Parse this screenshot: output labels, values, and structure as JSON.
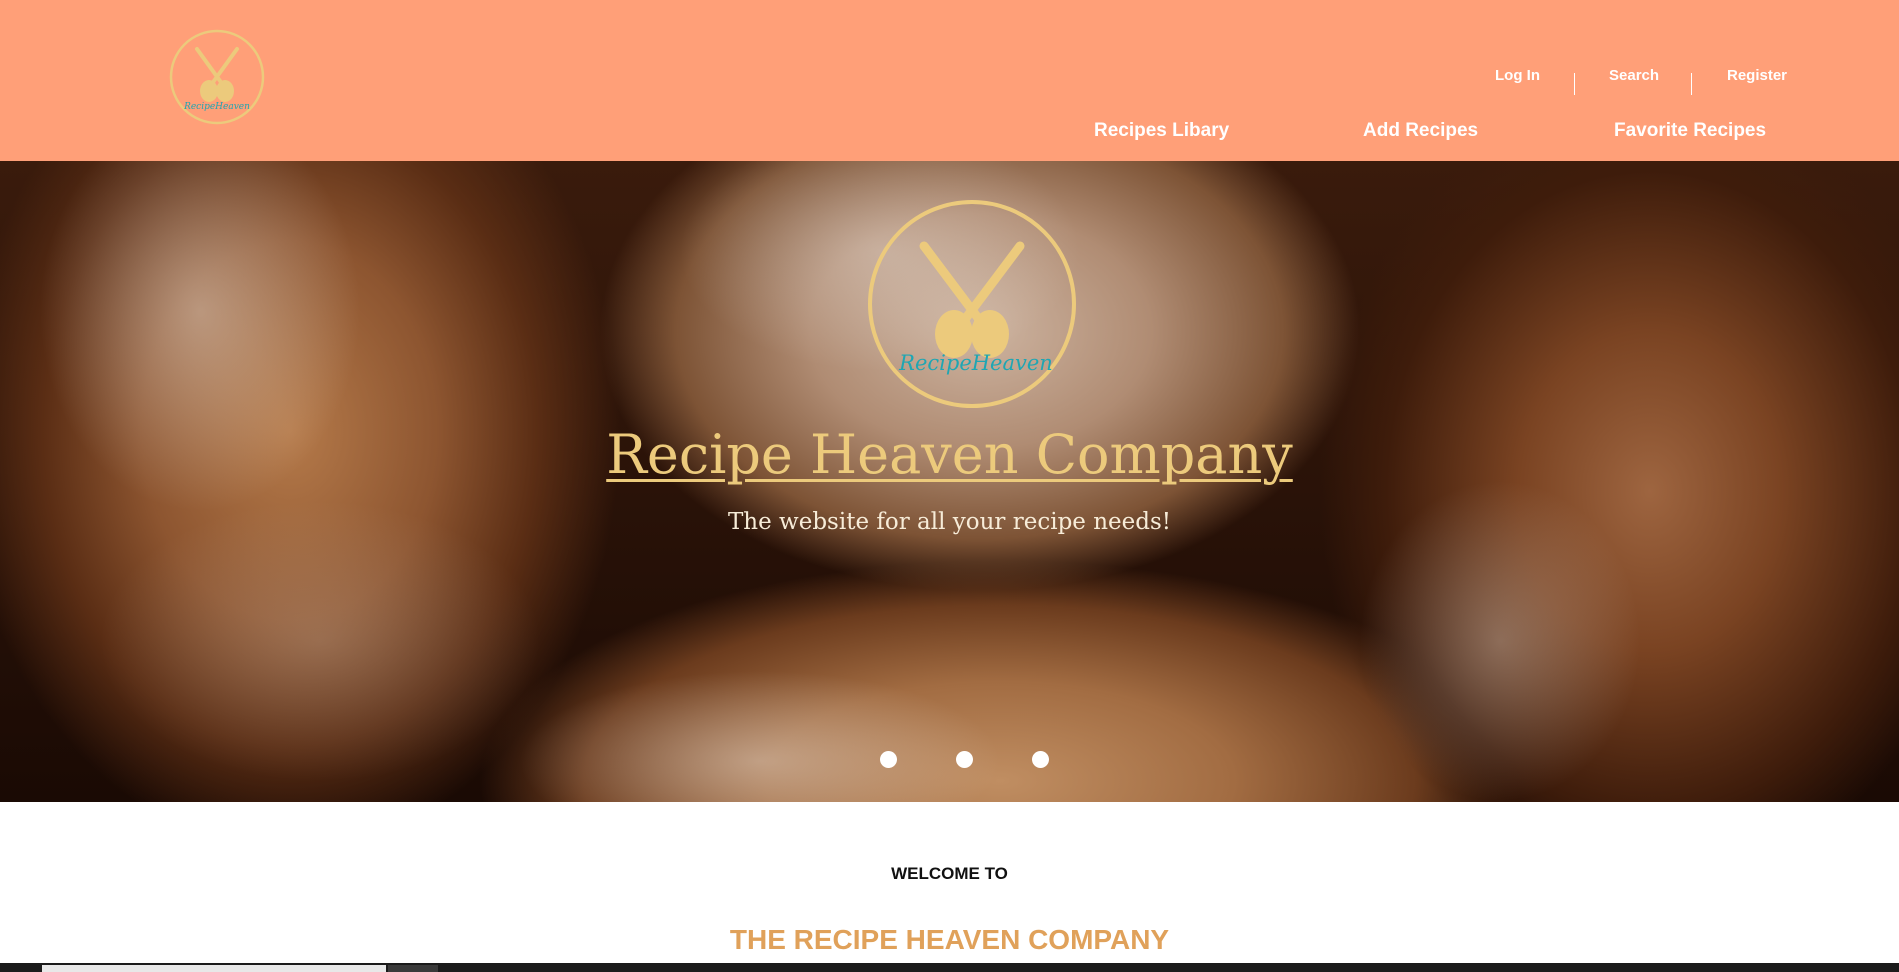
{
  "header": {
    "logo_text": "RecipeHeaven",
    "top_links": [
      "Log In",
      "Search",
      "Register"
    ],
    "nav": [
      "Recipes Libary",
      "Add Recipes",
      "Favorite Recipes"
    ]
  },
  "hero": {
    "logo_text": "RecipeHeaven",
    "title": "Recipe Heaven Company",
    "tagline": "The website for all your recipe needs!",
    "carousel_slides": 3
  },
  "welcome": {
    "kicker": "WELCOME TO",
    "title": "THE RECIPE HEAVEN COMPANY"
  },
  "colors": {
    "header_bg": "#ff9f78",
    "gold": "#ecca7c",
    "teal": "#1fa6b3",
    "welcome_title": "#e0a15a"
  },
  "icons": [
    "crossed-spoons-logo-icon"
  ]
}
